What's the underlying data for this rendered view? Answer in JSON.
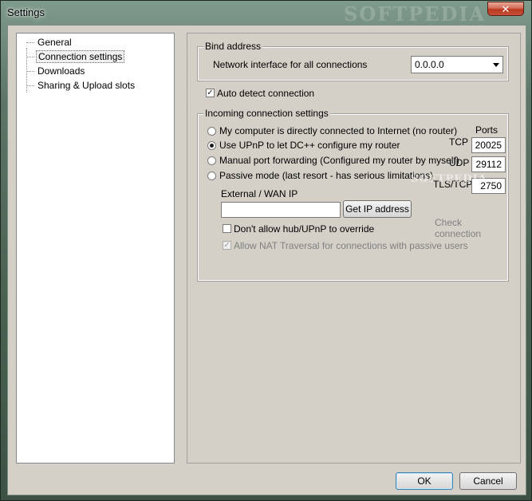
{
  "window": {
    "title": "Settings",
    "close_symbol": "✕",
    "watermark": "SOFTPEDIA"
  },
  "tree": {
    "items": [
      {
        "label": "General"
      },
      {
        "label": "Connection settings",
        "selected": true
      },
      {
        "label": "Downloads"
      },
      {
        "label": "Sharing & Upload slots"
      }
    ]
  },
  "bind_address": {
    "group_label": "Bind address",
    "interface_label": "Network interface for all connections",
    "interface_value": "0.0.0.0"
  },
  "auto_detect": {
    "label": "Auto detect connection",
    "checked": true,
    "check_symbol": "✓"
  },
  "incoming": {
    "group_label": "Incoming connection settings",
    "options": [
      {
        "label": "My computer is directly connected to Internet (no router)",
        "checked": false
      },
      {
        "label": "Use UPnP to let DC++ configure my router",
        "checked": true
      },
      {
        "label": "Manual port forwarding (Configured my router by myself)",
        "checked": false
      },
      {
        "label": "Passive mode (last resort - has serious limitations)",
        "checked": false
      }
    ],
    "ports_header": "Ports",
    "ports": [
      {
        "label": "TCP",
        "value": "20025"
      },
      {
        "label": "UDP",
        "value": "29112"
      },
      {
        "label": "TLS/TCP",
        "value": "2750"
      }
    ],
    "external_wan_label": "External / WAN IP",
    "external_wan_value": "",
    "get_ip_button": "Get IP address",
    "check_connection": "Check connection",
    "dont_allow_override": {
      "label": "Don't allow hub/UPnP to override",
      "checked": false
    },
    "allow_nat": {
      "label": "Allow NAT Traversal for connections with passive users",
      "checked": true,
      "disabled": true
    }
  },
  "footer": {
    "ok_label": "OK",
    "cancel_label": "Cancel"
  }
}
